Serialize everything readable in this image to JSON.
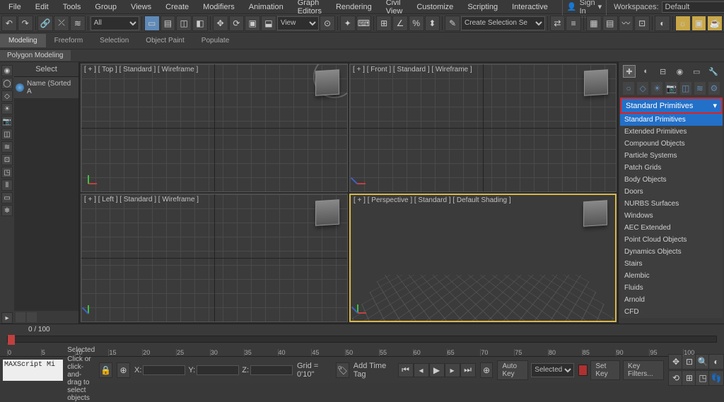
{
  "menu": {
    "items": [
      "File",
      "Edit",
      "Tools",
      "Group",
      "Views",
      "Create",
      "Modifiers",
      "Animation",
      "Graph Editors",
      "Rendering",
      "Civil View",
      "Customize",
      "Scripting",
      "Interactive"
    ]
  },
  "signin": {
    "label": "Sign In"
  },
  "workspaces": {
    "label": "Workspaces:",
    "value": "Default"
  },
  "toolbar": {
    "all": "All",
    "view": "View",
    "create_sel": "Create Selection Se"
  },
  "ribbon": {
    "tabs": [
      "Modeling",
      "Freeform",
      "Selection",
      "Object Paint",
      "Populate"
    ],
    "poly": "Polygon Modeling"
  },
  "scene_explorer": {
    "select": "Select",
    "name_sort": "Name (Sorted A"
  },
  "viewports": {
    "top": "[ + ] [ Top ]  [ Standard ]  [ Wireframe ]",
    "front": "[ + ] [ Front ]  [ Standard ]  [ Wireframe ]",
    "left": "[ + ] [ Left ]  [ Standard ]  [ Wireframe ]",
    "persp": "[ + ] [ Perspective ]  [ Standard ]  [ Default Shading ]"
  },
  "command_panel": {
    "dropdown_label": "Standard Primitives",
    "items": [
      "Standard Primitives",
      "Extended Primitives",
      "Compound Objects",
      "Particle Systems",
      "Patch Grids",
      "Body Objects",
      "Doors",
      "NURBS Surfaces",
      "Windows",
      "AEC Extended",
      "Point Cloud Objects",
      "Dynamics Objects",
      "Stairs",
      "Alembic",
      "Fluids",
      "Arnold",
      "CFD"
    ]
  },
  "timeline": {
    "counter": "0 / 100",
    "ticks": [
      "0",
      "5",
      "10",
      "15",
      "20",
      "25",
      "30",
      "35",
      "40",
      "45",
      "50",
      "55",
      "60",
      "65",
      "70",
      "75",
      "80",
      "85",
      "90",
      "95",
      "100"
    ]
  },
  "status": {
    "none_sel": "None Selected",
    "prompt": "Click or click-and-drag to select objects",
    "maxscript": "MAXScript Mi",
    "x": "X:",
    "y": "Y:",
    "z": "Z:",
    "grid": "Grid = 0'10\"",
    "add_tag": "Add Time Tag",
    "autokey": "Auto Key",
    "setkey": "Set Key",
    "selected": "Selected",
    "keyfilters": "Key Filters..."
  }
}
